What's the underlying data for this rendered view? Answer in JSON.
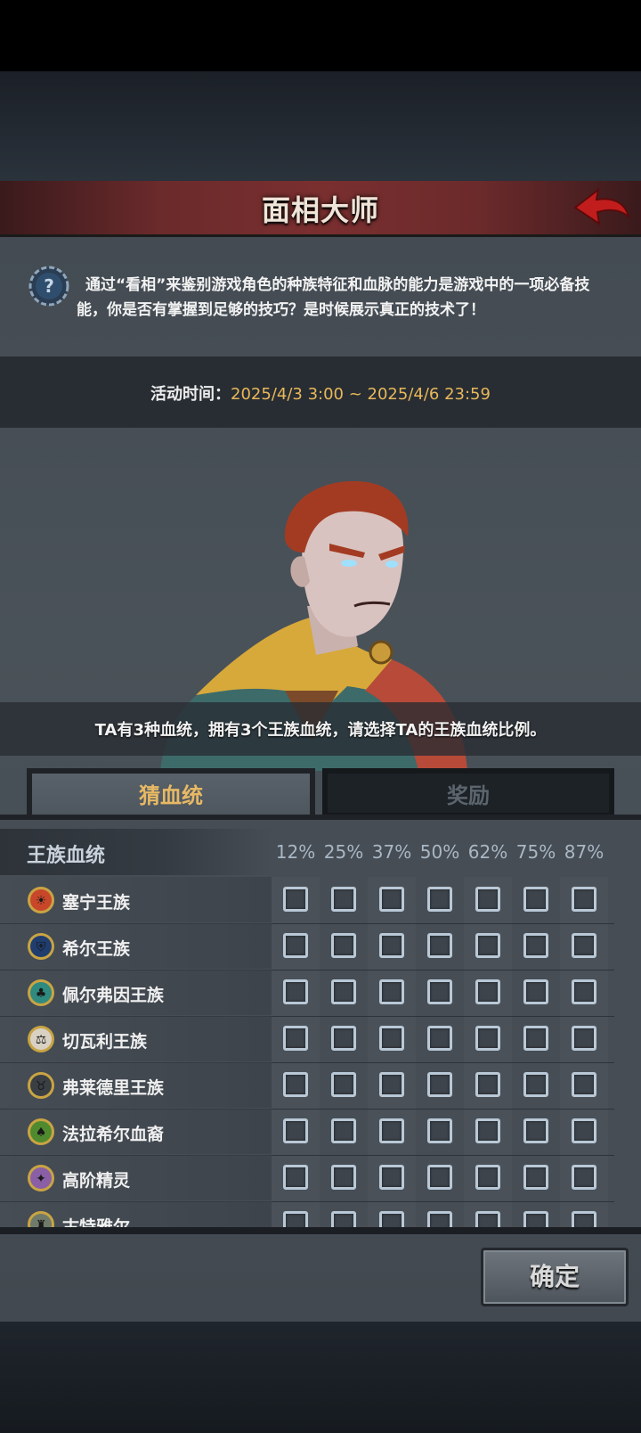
{
  "header": {
    "title": "面相大师"
  },
  "intro": {
    "text": "通过“看相”来鉴别游戏角色的种族特征和血脉的能力是游戏中的一项必备技能，你是否有掌握到足够的技巧？是时候展示真正的技术了！"
  },
  "event_time": {
    "label": "活动时间：",
    "value": "2025/4/3 3:00 ~ 2025/4/6 23:59"
  },
  "question": {
    "text": "TA有3种血统，拥有3个王族血统，请选择TA的王族血统比例。"
  },
  "tabs": [
    {
      "label": "猜血统",
      "active": true
    },
    {
      "label": "奖励",
      "active": false
    }
  ],
  "table": {
    "header_label": "王族血统",
    "percentages": [
      "12%",
      "25%",
      "37%",
      "50%",
      "62%",
      "75%",
      "87%"
    ],
    "rows": [
      {
        "name": "塞宁王族",
        "emblem": "sun-emblem-icon",
        "color": "#c8472a"
      },
      {
        "name": "希尔王族",
        "emblem": "helmet-emblem-icon",
        "color": "#1f3d6e"
      },
      {
        "name": "佩尔弗因王族",
        "emblem": "tree-emblem-icon",
        "color": "#2f8a80"
      },
      {
        "name": "切瓦利王族",
        "emblem": "scales-emblem-icon",
        "color": "#d9d2c4"
      },
      {
        "name": "弗莱德里王族",
        "emblem": "bull-emblem-icon",
        "color": "#3a3f44"
      },
      {
        "name": "法拉希尔血裔",
        "emblem": "oak-emblem-icon",
        "color": "#4f8a2e"
      },
      {
        "name": "高阶精灵",
        "emblem": "elf-emblem-icon",
        "color": "#8a5fa6"
      },
      {
        "name": "古特雅尔",
        "emblem": "tusk-emblem-icon",
        "color": "#6f7a6a"
      }
    ]
  },
  "confirm": {
    "label": "确定"
  },
  "colors": {
    "accent": "#e7b964",
    "time_value": "#e8b85a",
    "header": "#7a2f2f"
  }
}
